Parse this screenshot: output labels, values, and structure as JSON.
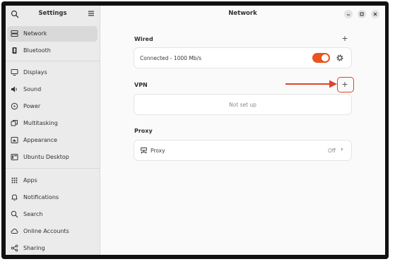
{
  "sidebar": {
    "title": "Settings",
    "items": [
      {
        "label": "Network",
        "icon": "network-icon",
        "active": true
      },
      {
        "label": "Bluetooth",
        "icon": "bluetooth-icon"
      },
      {
        "label": "Displays",
        "icon": "display-icon"
      },
      {
        "label": "Sound",
        "icon": "sound-icon"
      },
      {
        "label": "Power",
        "icon": "power-icon"
      },
      {
        "label": "Multitasking",
        "icon": "multitasking-icon"
      },
      {
        "label": "Appearance",
        "icon": "appearance-icon"
      },
      {
        "label": "Ubuntu Desktop",
        "icon": "ubuntu-desktop-icon"
      },
      {
        "label": "Apps",
        "icon": "apps-icon"
      },
      {
        "label": "Notifications",
        "icon": "bell-icon"
      },
      {
        "label": "Search",
        "icon": "search-icon"
      },
      {
        "label": "Online Accounts",
        "icon": "cloud-icon"
      },
      {
        "label": "Sharing",
        "icon": "share-icon"
      }
    ]
  },
  "main": {
    "title": "Network",
    "wired": {
      "title": "Wired",
      "add_label": "+",
      "connection": "Connected - 1000 Mb/s",
      "enabled": true
    },
    "vpn": {
      "title": "VPN",
      "add_label": "+",
      "status": "Not set up"
    },
    "proxy": {
      "title": "Proxy",
      "label": "Proxy",
      "value": "Off",
      "chevron": "›"
    }
  },
  "colors": {
    "accent": "#e95420",
    "annotation": "#e0442a",
    "sidebar_bg": "#ebebeb",
    "content_bg": "#fafafa"
  }
}
